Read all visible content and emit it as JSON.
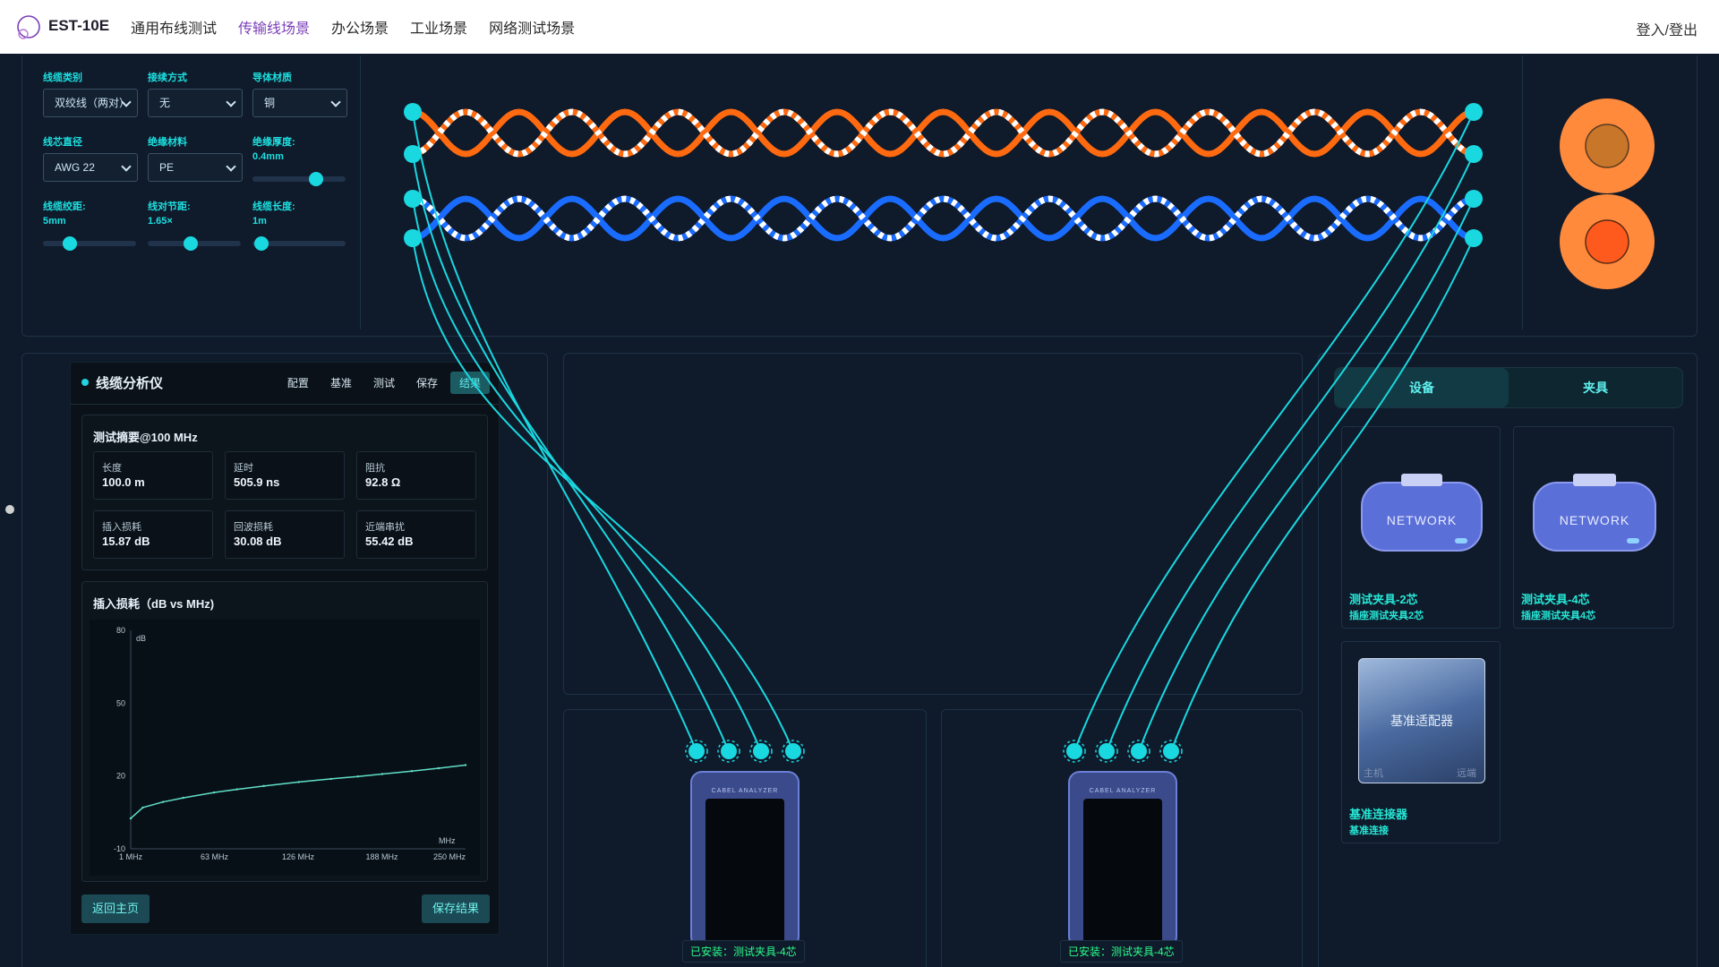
{
  "header": {
    "brand": "EST-10E",
    "nav": [
      "通用布线测试",
      "传输线场景",
      "办公场景",
      "工业场景",
      "网络测试场景"
    ],
    "active_nav": "传输线场景",
    "login": "登入/登出"
  },
  "controls": {
    "cable_type": {
      "label": "线缆类别",
      "value": "双绞线（两对）"
    },
    "connect_mode": {
      "label": "接续方式",
      "value": "无"
    },
    "conductor": {
      "label": "导体材质",
      "value": "铜"
    },
    "core_diameter": {
      "label": "线芯直径",
      "value": "AWG 22"
    },
    "insulation_material": {
      "label": "绝缘材料",
      "value": "PE"
    },
    "insulation_thickness": {
      "label": "绝缘厚度:",
      "value": "0.4mm",
      "level": 0.72
    },
    "lay_length": {
      "label": "线缆绞距:",
      "value": "5mm",
      "level": 0.25
    },
    "pair_pitch": {
      "label": "线对节距:",
      "value": "1.65×",
      "level": 0.45
    },
    "cable_length": {
      "label": "线缆长度:",
      "value": "1m",
      "level": 0.02
    }
  },
  "analyzer": {
    "title": "线缆分析仪",
    "tabs": [
      "配置",
      "基准",
      "测试",
      "保存",
      "结果"
    ],
    "active_tab": "结果",
    "summary_title": "测试摘要@100 MHz",
    "metrics": [
      {
        "key": "长度",
        "value": "100.0 m"
      },
      {
        "key": "延时",
        "value": "505.9 ns"
      },
      {
        "key": "阻抗",
        "value": "92.8 Ω"
      },
      {
        "key": "插入损耗",
        "value": "15.87 dB"
      },
      {
        "key": "回波损耗",
        "value": "30.08 dB"
      },
      {
        "key": "近端串扰",
        "value": "55.42 dB"
      }
    ],
    "chart_title": "插入损耗（dB vs MHz)",
    "back_button": "返回主页",
    "save_button": "保存结果"
  },
  "chart_data": {
    "type": "line",
    "title": "插入损耗（dB vs MHz)",
    "ylabel": "dB",
    "xlabel": "MHz",
    "x_ticks": [
      "1 MHz",
      "63 MHz",
      "126 MHz",
      "188 MHz",
      "250 MHz"
    ],
    "y_ticks": [
      80,
      50,
      20,
      -10
    ],
    "ylim": [
      -10,
      80
    ],
    "xlim": [
      1,
      250
    ],
    "series": [
      {
        "x": [
          1,
          10,
          25,
          40,
          63,
          80,
          100,
          126,
          150,
          170,
          188,
          210,
          230,
          250
        ],
        "values": [
          2.5,
          7.0,
          9.3,
          11.0,
          13.2,
          14.5,
          15.87,
          17.5,
          18.8,
          19.8,
          20.8,
          22.0,
          23.2,
          24.5
        ]
      }
    ],
    "color": "#5fe0c8",
    "grid": false
  },
  "testers": [
    {
      "status": "已安装：测试夹具-4芯",
      "brand_text": "CABEL ANALYZER"
    },
    {
      "status": "已安装：测试夹具-4芯",
      "brand_text": "CABEL ANALYZER"
    }
  ],
  "device_panel": {
    "tabs": [
      "设备",
      "夹具"
    ],
    "active_tab": "设备",
    "items": [
      {
        "name": "测试夹具-2芯",
        "sub": "插座测试夹具2芯",
        "label": "NETWORK"
      },
      {
        "name": "测试夹具-4芯",
        "sub": "插座测试夹具4芯",
        "label": "NETWORK"
      },
      {
        "name": "基准连接器",
        "sub": "基准连接",
        "label": "基准适配器",
        "left": "主机",
        "right": "远端"
      }
    ]
  },
  "colors": {
    "accent": "#19d8e0",
    "orange": "#ff6a10",
    "blue": "#1a6cff",
    "bg": "#0f1a2b"
  }
}
